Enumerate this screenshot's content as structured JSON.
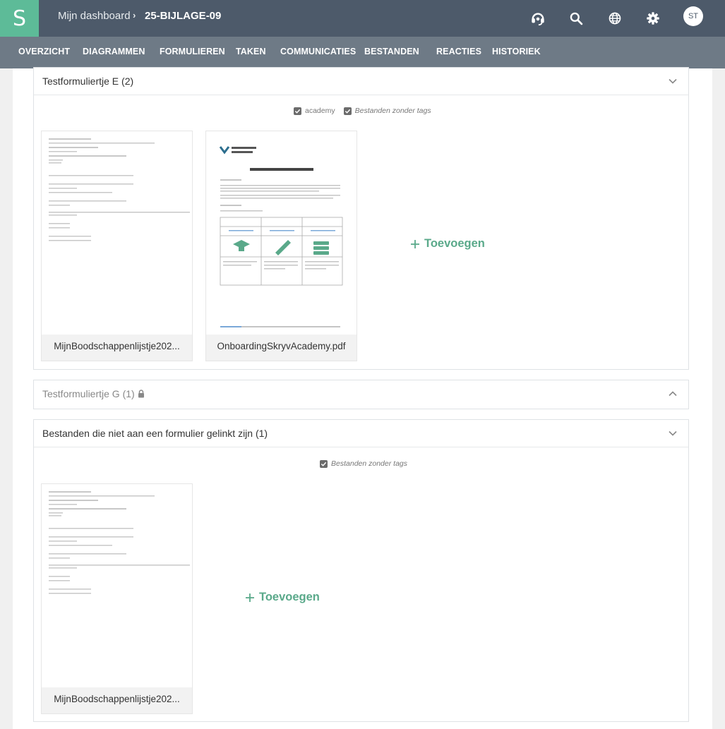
{
  "app": {
    "logo_letter": "S"
  },
  "breadcrumb": {
    "home": "Mijn dashboard",
    "separator": "›",
    "current": "25-BIJLAGE-09"
  },
  "user": {
    "initials": "ST"
  },
  "icons": {
    "support": "headset-icon",
    "search": "search-icon",
    "language": "globe-icon",
    "settings": "gear-icon"
  },
  "nav": {
    "tabs": [
      {
        "label": "OVERZICHT"
      },
      {
        "label": "DIAGRAMMEN"
      },
      {
        "label": "FORMULIEREN"
      },
      {
        "label": "TAKEN"
      },
      {
        "label": "COMMUNICATIES"
      },
      {
        "label": "BESTANDEN",
        "active": true
      },
      {
        "label": "REACTIES"
      },
      {
        "label": "HISTORIEK"
      }
    ]
  },
  "sections": [
    {
      "title": "Testformuliertje E (2)",
      "expanded": true,
      "tags": [
        "academy",
        "Bestanden zonder tags"
      ],
      "files": [
        "MijnBoodschappenlijstje202...",
        "OnboardingSkryvAcademy.pdf"
      ],
      "add_label": "Toevoegen"
    },
    {
      "title": "Testformuliertje G (1)",
      "expanded": false,
      "locked": true
    },
    {
      "title": "Bestanden die niet aan een formulier gelinkt zijn (1)",
      "expanded": true,
      "tags": [
        "Bestanden zonder tags"
      ],
      "files": [
        "MijnBoodschappenlijstje202..."
      ],
      "add_label": "Toevoegen"
    }
  ],
  "colors": {
    "topbar": "#4d5a6a",
    "navbar": "#6e7a86",
    "accent": "#5dbb98",
    "add": "#5aa98a"
  }
}
